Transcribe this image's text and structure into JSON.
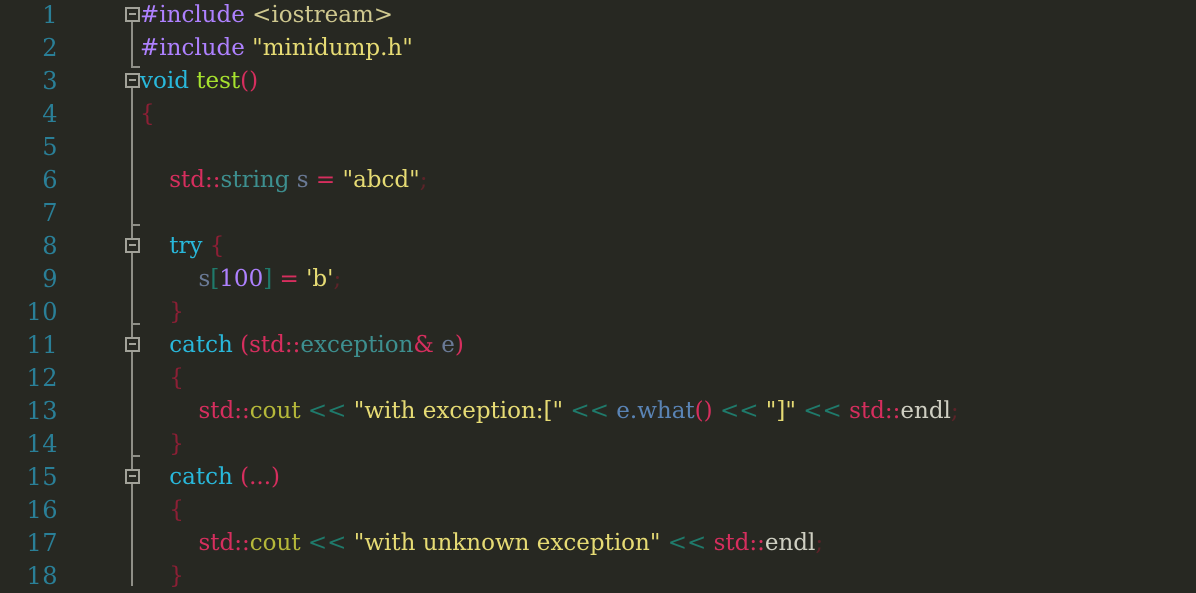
{
  "editor": {
    "name": "code-editor",
    "language": "cpp",
    "background_color": "#272822",
    "line_number_color": "#2a7f97",
    "fold_marker_color": "#a2a299",
    "total_visible_lines": 18,
    "line_height_px": 33,
    "font_size_px": 23
  },
  "gutter": {
    "line_numbers": [
      "1",
      "2",
      "3",
      "4",
      "5",
      "6",
      "7",
      "8",
      "9",
      "10",
      "11",
      "12",
      "13",
      "14",
      "15",
      "16",
      "17",
      "18"
    ]
  },
  "fold_markers": [
    {
      "line": 1,
      "state": "expanded",
      "glyph": "minus"
    },
    {
      "line": 3,
      "state": "expanded",
      "glyph": "minus"
    },
    {
      "line": 8,
      "state": "expanded",
      "glyph": "minus"
    },
    {
      "line": 11,
      "state": "expanded",
      "glyph": "minus"
    },
    {
      "line": 15,
      "state": "expanded",
      "glyph": "minus"
    }
  ],
  "code": {
    "lines": [
      {
        "number": "1",
        "text": "#include <iostream>",
        "tokens": [
          {
            "t": "#include",
            "c": "t-pre"
          },
          {
            "t": " ",
            "c": "t-plain"
          },
          {
            "t": "<iostream>",
            "c": "t-inc"
          }
        ]
      },
      {
        "number": "2",
        "text": "#include \"minidump.h\"",
        "tokens": [
          {
            "t": "#include",
            "c": "t-pre"
          },
          {
            "t": " ",
            "c": "t-plain"
          },
          {
            "t": "\"minidump.h\"",
            "c": "t-str"
          }
        ]
      },
      {
        "number": "3",
        "text": "void test()",
        "tokens": [
          {
            "t": "void",
            "c": "t-kw"
          },
          {
            "t": " ",
            "c": "t-plain"
          },
          {
            "t": "test",
            "c": "t-fn"
          },
          {
            "t": "()",
            "c": "t-paren"
          }
        ]
      },
      {
        "number": "4",
        "text": "{",
        "tokens": [
          {
            "t": "{",
            "c": "t-brace"
          }
        ]
      },
      {
        "number": "5",
        "text": "",
        "tokens": []
      },
      {
        "number": "6",
        "text": "    std::string s = \"abcd\";",
        "tokens": [
          {
            "t": "    ",
            "c": "t-plain"
          },
          {
            "t": "std::",
            "c": "t-ns"
          },
          {
            "t": "string",
            "c": "t-type"
          },
          {
            "t": " ",
            "c": "t-plain"
          },
          {
            "t": "s",
            "c": "t-var"
          },
          {
            "t": " ",
            "c": "t-plain"
          },
          {
            "t": "=",
            "c": "t-op"
          },
          {
            "t": " ",
            "c": "t-plain"
          },
          {
            "t": "\"abcd\"",
            "c": "t-str"
          },
          {
            "t": ";",
            "c": "t-semi"
          }
        ]
      },
      {
        "number": "7",
        "text": "",
        "tokens": []
      },
      {
        "number": "8",
        "text": "    try {",
        "tokens": [
          {
            "t": "    ",
            "c": "t-plain"
          },
          {
            "t": "try",
            "c": "t-kw"
          },
          {
            "t": " ",
            "c": "t-plain"
          },
          {
            "t": "{",
            "c": "t-brace"
          }
        ]
      },
      {
        "number": "9",
        "text": "        s[100] = 'b';",
        "tokens": [
          {
            "t": "        ",
            "c": "t-plain"
          },
          {
            "t": "s",
            "c": "t-var"
          },
          {
            "t": "[",
            "c": "t-brkt"
          },
          {
            "t": "100",
            "c": "t-num"
          },
          {
            "t": "]",
            "c": "t-brkt"
          },
          {
            "t": " ",
            "c": "t-plain"
          },
          {
            "t": "=",
            "c": "t-op"
          },
          {
            "t": " ",
            "c": "t-plain"
          },
          {
            "t": "'b'",
            "c": "t-str"
          },
          {
            "t": ";",
            "c": "t-semi"
          }
        ]
      },
      {
        "number": "10",
        "text": "    }",
        "tokens": [
          {
            "t": "    ",
            "c": "t-plain"
          },
          {
            "t": "}",
            "c": "t-brace"
          }
        ]
      },
      {
        "number": "11",
        "text": "    catch (std::exception& e)",
        "tokens": [
          {
            "t": "    ",
            "c": "t-plain"
          },
          {
            "t": "catch",
            "c": "t-kw"
          },
          {
            "t": " ",
            "c": "t-plain"
          },
          {
            "t": "(",
            "c": "t-paren"
          },
          {
            "t": "std::",
            "c": "t-ns"
          },
          {
            "t": "exception",
            "c": "t-type"
          },
          {
            "t": "&",
            "c": "t-amp"
          },
          {
            "t": " ",
            "c": "t-plain"
          },
          {
            "t": "e",
            "c": "t-var"
          },
          {
            "t": ")",
            "c": "t-paren"
          }
        ]
      },
      {
        "number": "12",
        "text": "    {",
        "tokens": [
          {
            "t": "    ",
            "c": "t-plain"
          },
          {
            "t": "{",
            "c": "t-brace"
          }
        ]
      },
      {
        "number": "13",
        "text": "        std::cout << \"with exception:[\" << e.what() << \"]\" << std::endl;",
        "tokens": [
          {
            "t": "        ",
            "c": "t-plain"
          },
          {
            "t": "std::",
            "c": "t-ns"
          },
          {
            "t": "cout",
            "c": "t-cout"
          },
          {
            "t": " ",
            "c": "t-plain"
          },
          {
            "t": "<<",
            "c": "t-shift"
          },
          {
            "t": " ",
            "c": "t-plain"
          },
          {
            "t": "\"with exception:[\"",
            "c": "t-str"
          },
          {
            "t": " ",
            "c": "t-plain"
          },
          {
            "t": "<<",
            "c": "t-shift"
          },
          {
            "t": " ",
            "c": "t-plain"
          },
          {
            "t": "e.what",
            "c": "t-member"
          },
          {
            "t": "()",
            "c": "t-paren"
          },
          {
            "t": " ",
            "c": "t-plain"
          },
          {
            "t": "<<",
            "c": "t-shift"
          },
          {
            "t": " ",
            "c": "t-plain"
          },
          {
            "t": "\"]\"",
            "c": "t-str"
          },
          {
            "t": " ",
            "c": "t-plain"
          },
          {
            "t": "<<",
            "c": "t-shift"
          },
          {
            "t": " ",
            "c": "t-plain"
          },
          {
            "t": "std::",
            "c": "t-ns"
          },
          {
            "t": "endl",
            "c": "t-plain"
          },
          {
            "t": ";",
            "c": "t-semi"
          }
        ]
      },
      {
        "number": "14",
        "text": "    }",
        "tokens": [
          {
            "t": "    ",
            "c": "t-plain"
          },
          {
            "t": "}",
            "c": "t-brace"
          }
        ]
      },
      {
        "number": "15",
        "text": "    catch (...)",
        "tokens": [
          {
            "t": "    ",
            "c": "t-plain"
          },
          {
            "t": "catch",
            "c": "t-kw"
          },
          {
            "t": " ",
            "c": "t-plain"
          },
          {
            "t": "(...)",
            "c": "t-paren"
          }
        ]
      },
      {
        "number": "16",
        "text": "    {",
        "tokens": [
          {
            "t": "    ",
            "c": "t-plain"
          },
          {
            "t": "{",
            "c": "t-brace"
          }
        ]
      },
      {
        "number": "17",
        "text": "        std::cout << \"with unknown exception\" << std::endl;",
        "tokens": [
          {
            "t": "        ",
            "c": "t-plain"
          },
          {
            "t": "std::",
            "c": "t-ns"
          },
          {
            "t": "cout",
            "c": "t-cout"
          },
          {
            "t": " ",
            "c": "t-plain"
          },
          {
            "t": "<<",
            "c": "t-shift"
          },
          {
            "t": " ",
            "c": "t-plain"
          },
          {
            "t": "\"with unknown exception\"",
            "c": "t-str"
          },
          {
            "t": " ",
            "c": "t-plain"
          },
          {
            "t": "<<",
            "c": "t-shift"
          },
          {
            "t": " ",
            "c": "t-plain"
          },
          {
            "t": "std::",
            "c": "t-ns"
          },
          {
            "t": "endl",
            "c": "t-plain"
          },
          {
            "t": ";",
            "c": "t-semi"
          }
        ]
      },
      {
        "number": "18",
        "text": "    }",
        "tokens": [
          {
            "t": "    ",
            "c": "t-plain"
          },
          {
            "t": "}",
            "c": "t-brace"
          }
        ]
      }
    ]
  }
}
